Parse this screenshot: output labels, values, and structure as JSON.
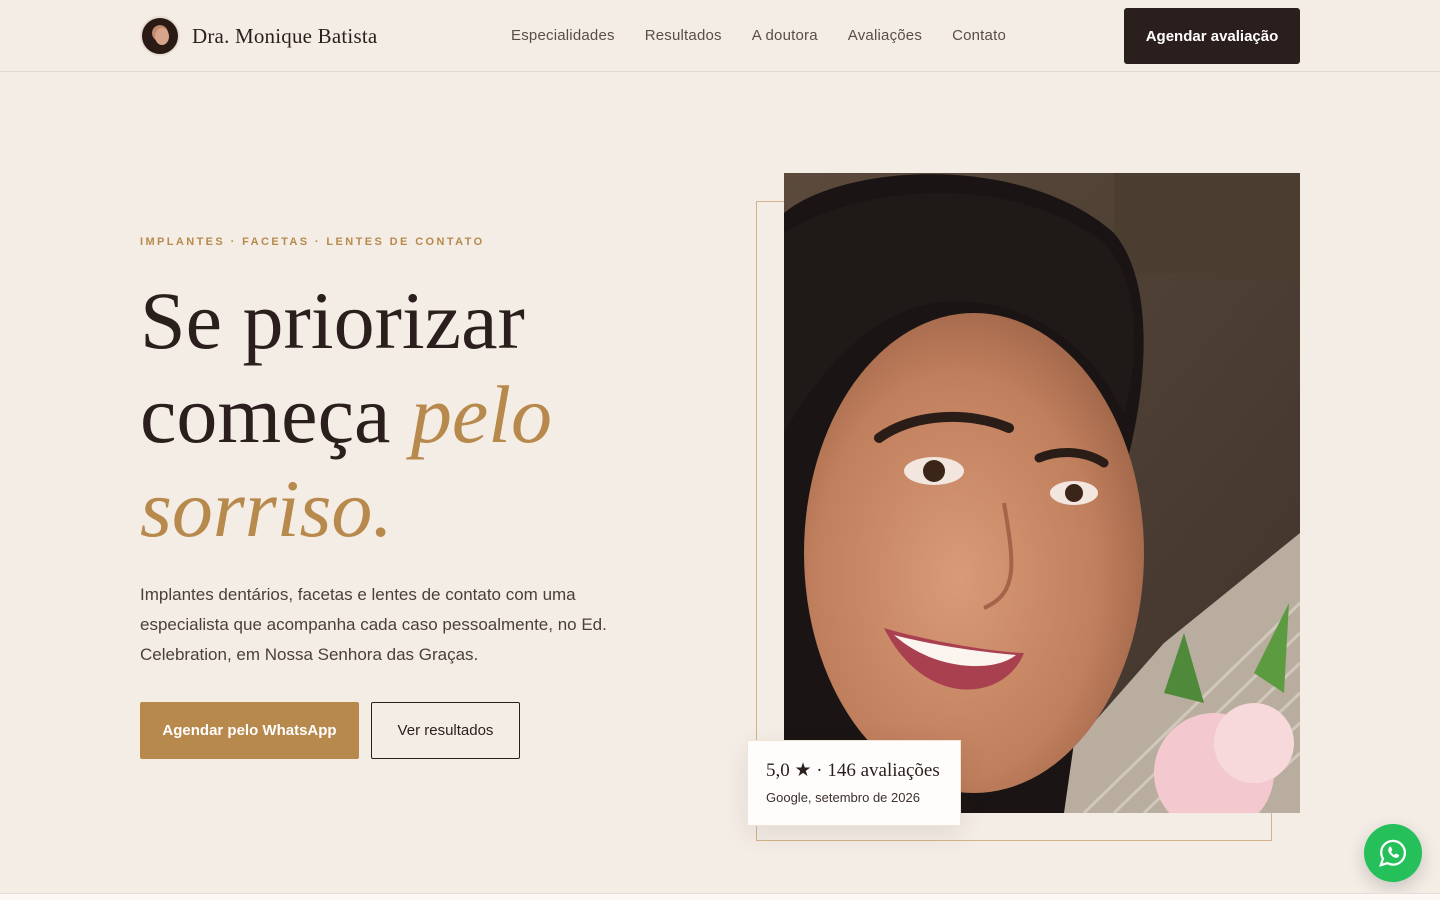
{
  "header": {
    "brand_name": "Dra. Monique Batista",
    "nav": [
      "Especialidades",
      "Resultados",
      "A doutora",
      "Avaliações",
      "Contato"
    ],
    "cta": "Agendar avaliação"
  },
  "hero": {
    "eyebrow": "IMPLANTES · FACETAS · LENTES DE CONTATO",
    "headline_line1": "Se priorizar",
    "headline_line2": "começa",
    "headline_accent1": "pelo",
    "headline_accent2": "sorriso.",
    "lead": "Implantes dentários, facetas e lentes de contato com uma especialista que acompanha cada caso pessoalmente, no Ed. Celebration, em Nossa Senhora das Graças.",
    "primary_button": "Agendar pelo WhatsApp",
    "secondary_button": "Ver resultados"
  },
  "rating": {
    "headline": "5,0 ★ · 146 avaliações",
    "source": "Google, setembro de 2026"
  },
  "colors": {
    "background": "#f4ede6",
    "dark": "#2b1f1d",
    "accent_gold": "#b8894c",
    "whatsapp_green": "#25c05a"
  },
  "icons": {
    "whatsapp": "whatsapp-icon",
    "avatar": "doctor-avatar"
  }
}
